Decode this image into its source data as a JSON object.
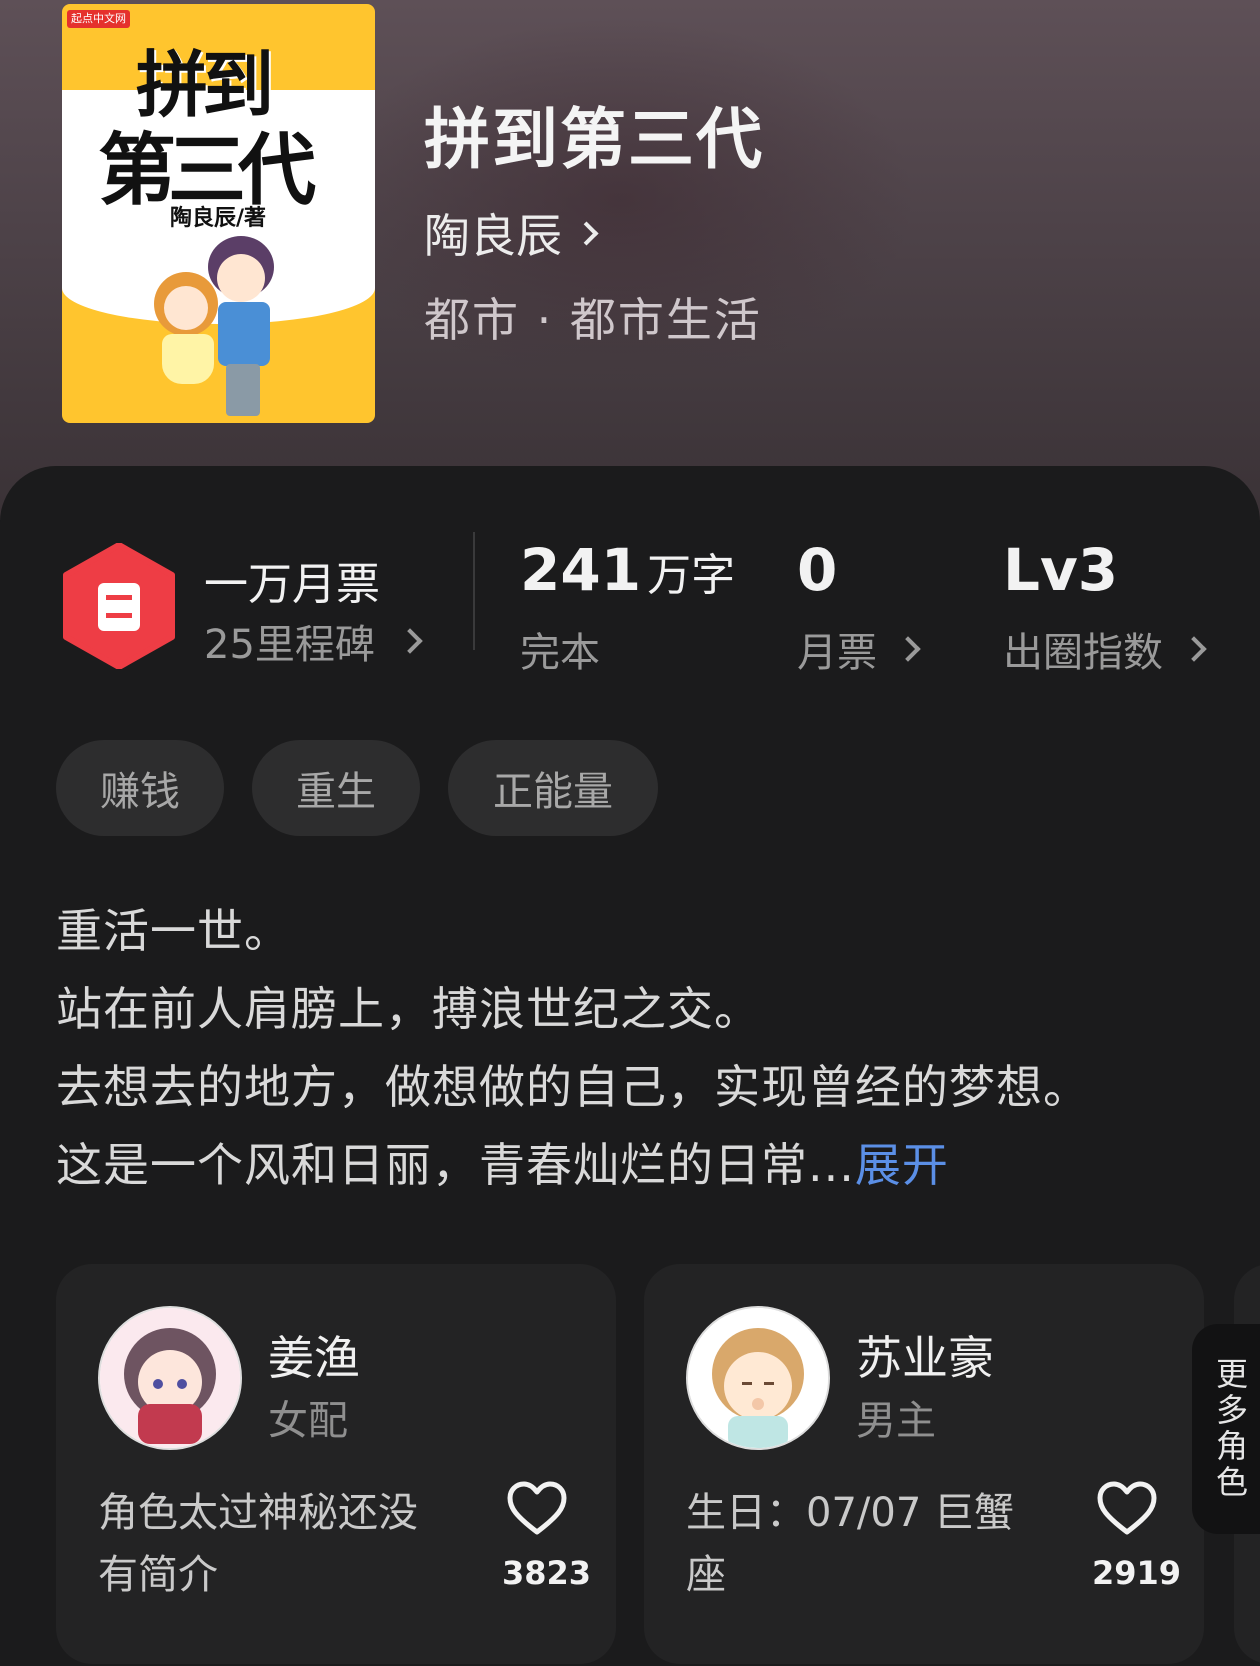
{
  "book": {
    "title": "拼到第三代",
    "author": "陶良辰",
    "genre": "都市 · 都市生活",
    "cover": {
      "publisher_logo": "起点中文网",
      "title_line1": "拼到",
      "title_line2": "第三代",
      "author_credit": "陶良辰/著"
    }
  },
  "stats": {
    "milestone_title": "一万月票",
    "milestone_sub": "25里程碑",
    "word_count_value": "241",
    "word_count_unit": "万字",
    "status": "完本",
    "monthly_ticket_value": "0",
    "monthly_ticket_label": "月票",
    "circle_index_value": "Lv3",
    "circle_index_label": "出圈指数"
  },
  "tags": [
    "赚钱",
    "重生",
    "正能量"
  ],
  "description": {
    "lines": [
      "重活一世。",
      "站在前人肩膀上，搏浪世纪之交。",
      "去想去的地方，做想做的自己，实现曾经的梦想。",
      "这是一个风和日丽，青春灿烂的日常..."
    ],
    "expand_label": "展开",
    "expand_color": "#5b8fe6"
  },
  "characters": [
    {
      "name": "姜渔",
      "role": "女配",
      "desc": "角色太过神秘还没有简介",
      "likes": "3823"
    },
    {
      "name": "苏业豪",
      "role": "男主",
      "desc": "生日：07/07 巨蟹座",
      "likes": "2919"
    }
  ],
  "more_roles": "更多角色",
  "colors": {
    "ticket_badge": "#ee3d45",
    "panel_bg": "#1b1b1c",
    "card_bg": "#232324",
    "cover_yellow": "#ffc52e"
  },
  "icons": {
    "ticket": "ticket-icon",
    "chevron": "chevron-right-icon",
    "heart": "heart-outline-icon"
  }
}
